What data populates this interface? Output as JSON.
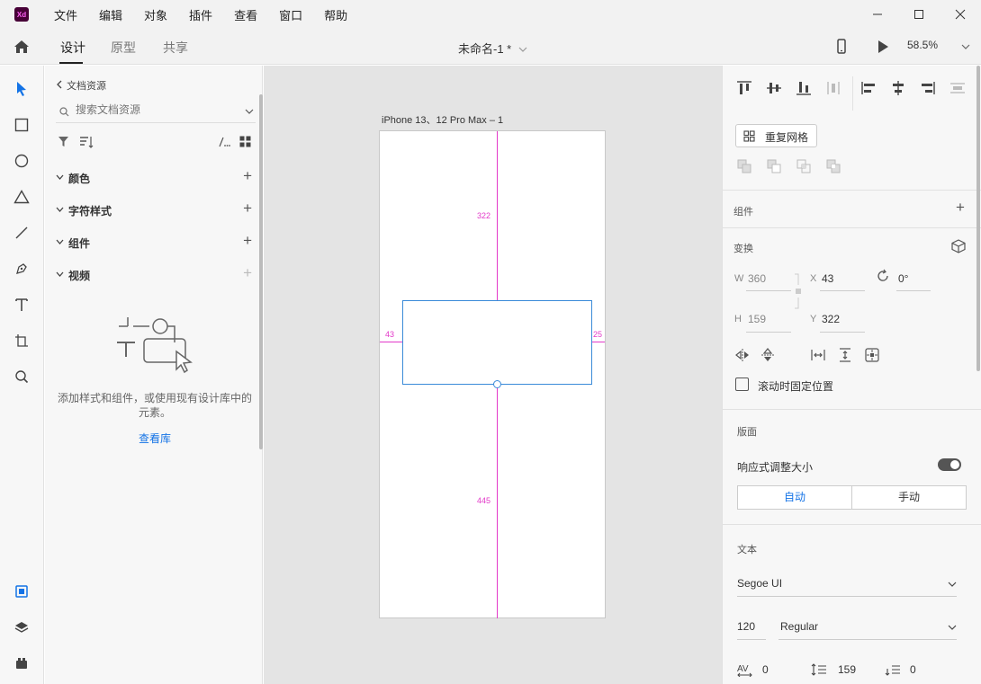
{
  "app": {
    "logo_text": "Xd"
  },
  "menu": {
    "items": [
      "文件",
      "编辑",
      "对象",
      "插件",
      "查看",
      "窗口",
      "帮助"
    ]
  },
  "toolbar": {
    "tabs": [
      "设计",
      "原型",
      "共享"
    ],
    "doc_title": "未命名-1 *",
    "zoom": "58.5%"
  },
  "assets": {
    "back_label": "文档资源",
    "search_placeholder": "搜索文档资源",
    "sections": [
      "颜色",
      "字符样式",
      "组件",
      "视频"
    ],
    "empty_message": "添加样式和组件，或使用现有设计库中的元素。",
    "view_library": "查看库"
  },
  "canvas": {
    "artboard_name": "iPhone 13、12 Pro Max – 1",
    "measure_top": "322",
    "measure_left": "43",
    "measure_right": "25",
    "measure_bottom": "445"
  },
  "inspector": {
    "repeat_grid": "重复网格",
    "component_title": "组件",
    "transform_title": "变换",
    "w_label": "W",
    "w_value": "360",
    "x_label": "X",
    "x_value": "43",
    "rotation": "0°",
    "h_label": "H",
    "h_value": "159",
    "y_label": "Y",
    "y_value": "322",
    "fix_position": "滚动时固定位置",
    "layout_title": "版面",
    "responsive_resize": "响应式调整大小",
    "responsive_on": true,
    "auto": "自动",
    "manual": "手动",
    "text_title": "文本",
    "font_family": "Segoe UI",
    "font_size": "120",
    "font_weight": "Regular",
    "char_spacing": "0",
    "line_spacing": "159",
    "para_spacing": "0",
    "accent_color": "#1473e6"
  }
}
